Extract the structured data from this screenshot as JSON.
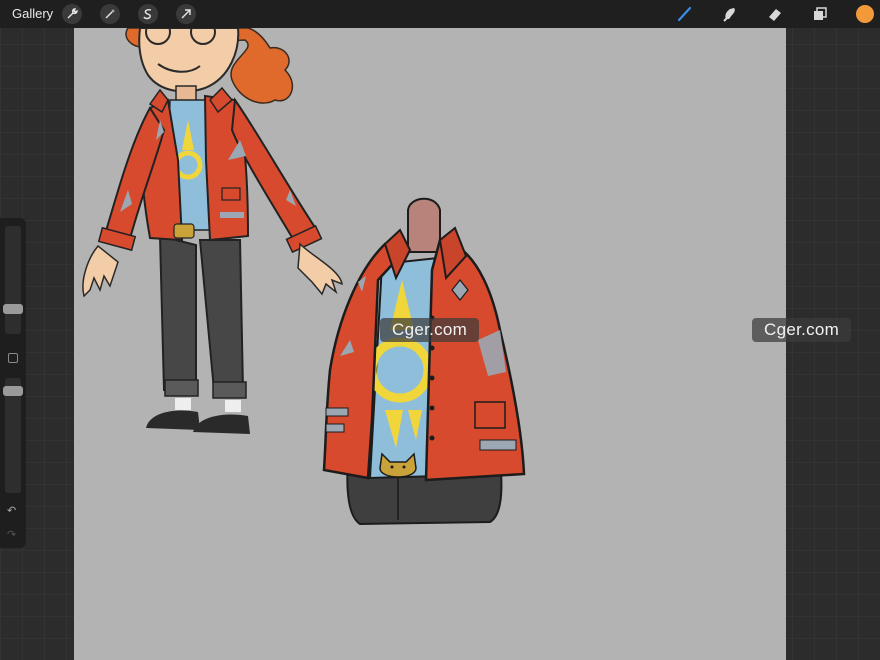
{
  "topbar": {
    "gallery_label": "Gallery",
    "left_tools": [
      "wrench-icon",
      "magic-wand-icon",
      "selection-icon",
      "transform-arrow-icon"
    ],
    "right_tools": [
      "brush-icon",
      "smudge-icon",
      "eraser-icon",
      "layers-icon"
    ],
    "active_tool": "brush-icon",
    "current_color": "#f29a3a"
  },
  "sidebar": {
    "brush_size_level": 0.3,
    "opacity_level": 0.6
  },
  "canvas": {
    "background": "#b3b3b3"
  },
  "watermark": {
    "text": "Cger.com"
  }
}
